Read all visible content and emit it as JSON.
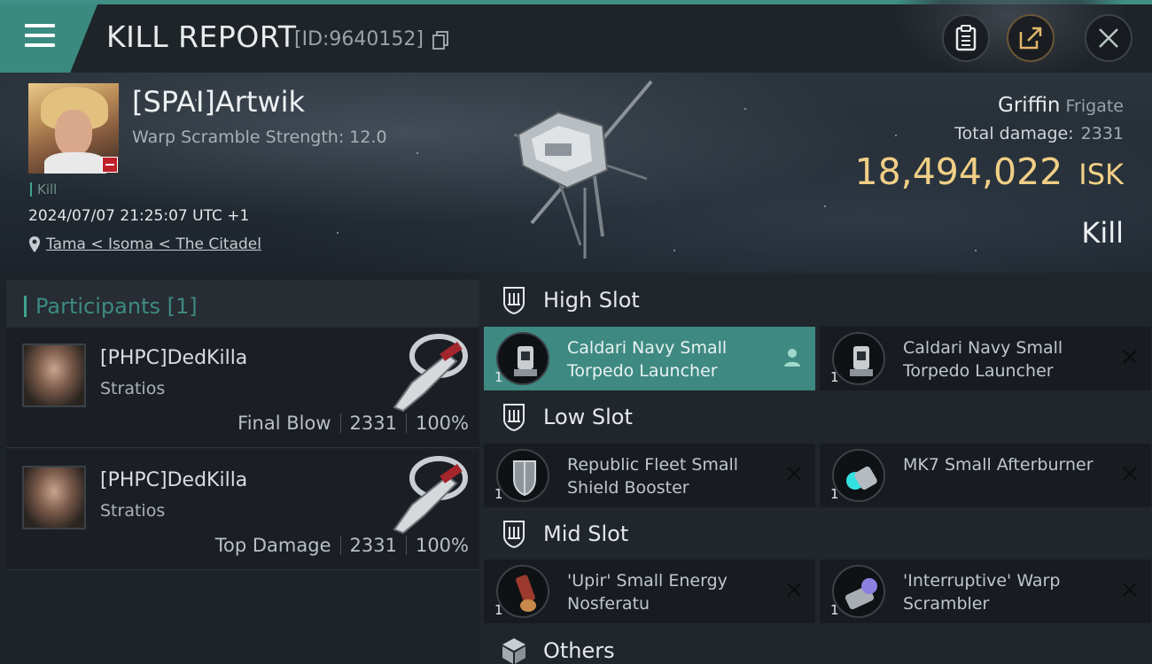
{
  "header": {
    "title": "KILL REPORT",
    "report_id": "[ID:9640152]"
  },
  "victim": {
    "name": "[SPAI]Artwik",
    "scramble": "Warp Scramble Strength: 12.0",
    "kill_tag": "Kill",
    "datetime": "2024/07/07 21:25:07 UTC +1",
    "location": "Tama < Isoma < The Citadel",
    "ship": "Griffin",
    "ship_class": "Frigate",
    "total_damage_label": "Total damage:",
    "total_damage": "2331",
    "isk_value": "18,494,022",
    "isk_unit": "ISK",
    "result": "Kill"
  },
  "participants": {
    "label": "Participants",
    "count": "[1]",
    "rows": [
      {
        "name": "[PHPC]DedKilla",
        "ship": "Stratios",
        "role": "Final Blow",
        "damage": "2331",
        "percent": "100%"
      },
      {
        "name": "[PHPC]DedKilla",
        "ship": "Stratios",
        "role": "Top Damage",
        "damage": "2331",
        "percent": "100%"
      }
    ]
  },
  "slots": {
    "high": {
      "label": "High Slot",
      "items": [
        {
          "name": "Caldari Navy Small Torpedo Launcher",
          "qty": "1"
        },
        {
          "name": "Caldari Navy Small Torpedo Launcher",
          "qty": "1"
        }
      ]
    },
    "low": {
      "label": "Low Slot",
      "items": [
        {
          "name": "Republic Fleet Small Shield Booster",
          "qty": "1"
        },
        {
          "name": "MK7 Small Afterburner",
          "qty": "1"
        }
      ]
    },
    "mid": {
      "label": "Mid Slot",
      "items": [
        {
          "name": "'Upir' Small Energy Nosferatu",
          "qty": "1"
        },
        {
          "name": "'Interruptive' Warp Scrambler",
          "qty": "1"
        }
      ]
    },
    "others": {
      "label": "Others"
    }
  },
  "icons": {
    "menu": "menu-icon",
    "copy": "copy-icon",
    "clipboard": "clipboard-icon",
    "share": "share-icon",
    "close": "close-icon",
    "location": "location-pin-icon",
    "slot": "slot-shield-icon",
    "others": "cube-icon",
    "remove": "close-icon",
    "person": "person-icon"
  },
  "colors": {
    "accent": "#3f8f86",
    "isk": "#f1cf86",
    "selected_item": "#3e8a82",
    "danger_badge": "#c0202a"
  }
}
